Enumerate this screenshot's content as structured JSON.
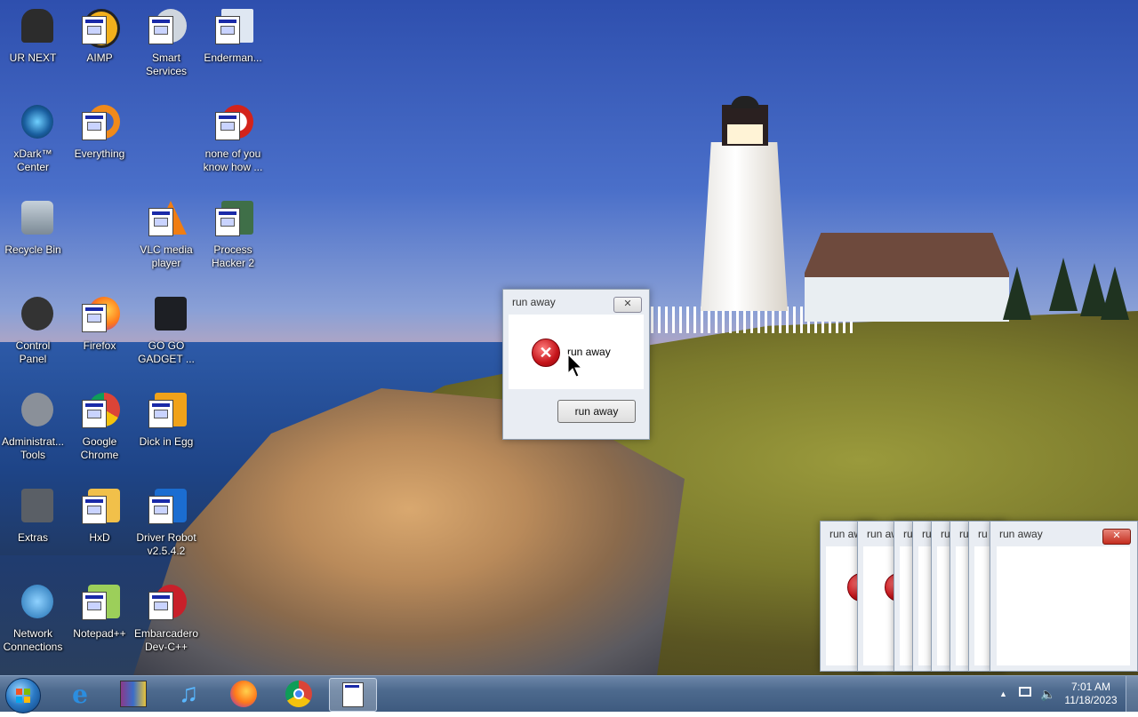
{
  "desktop": {
    "icons": [
      {
        "label": "UR NEXT"
      },
      {
        "label": "AIMP"
      },
      {
        "label": "Smart Services"
      },
      {
        "label": "Enderman..."
      },
      {
        "label": "xDark™ Center"
      },
      {
        "label": "Everything"
      },
      {
        "label": "none of you know how ..."
      },
      {
        "label": "Recycle Bin"
      },
      {
        "label": "VLC media player"
      },
      {
        "label": "Process Hacker 2"
      },
      {
        "label": "Control Panel"
      },
      {
        "label": "Firefox"
      },
      {
        "label": "GO GO GADGET ..."
      },
      {
        "label": "Administrat... Tools"
      },
      {
        "label": "Google Chrome"
      },
      {
        "label": "Dick in Egg"
      },
      {
        "label": "Extras"
      },
      {
        "label": "HxD"
      },
      {
        "label": "Driver Robot v2.5.4.2"
      },
      {
        "label": "Network Connections"
      },
      {
        "label": "Notepad++"
      },
      {
        "label": "Embarcadero Dev-C++"
      }
    ]
  },
  "dialog": {
    "title": "run away",
    "message": "run away",
    "button": "run away",
    "close_glyph": "✕",
    "icon": "error-icon"
  },
  "stacked_dialogs": {
    "partial_title": "run aw",
    "short_title": "ru",
    "front_title": "run away",
    "close_glyph": "✕"
  },
  "taskbar": {
    "pinned": [
      "start-orb",
      "internet-explorer-icon",
      "winrar-icon",
      "itunes-icon",
      "firefox-icon",
      "chrome-icon",
      "app-window-icon"
    ],
    "clock": {
      "time": "7:01 AM",
      "date": "11/18/2023"
    },
    "tray_arrow": "▲"
  },
  "colors": {
    "accent_close": "#c42d1f",
    "taskbar": "#4d6a8e"
  }
}
